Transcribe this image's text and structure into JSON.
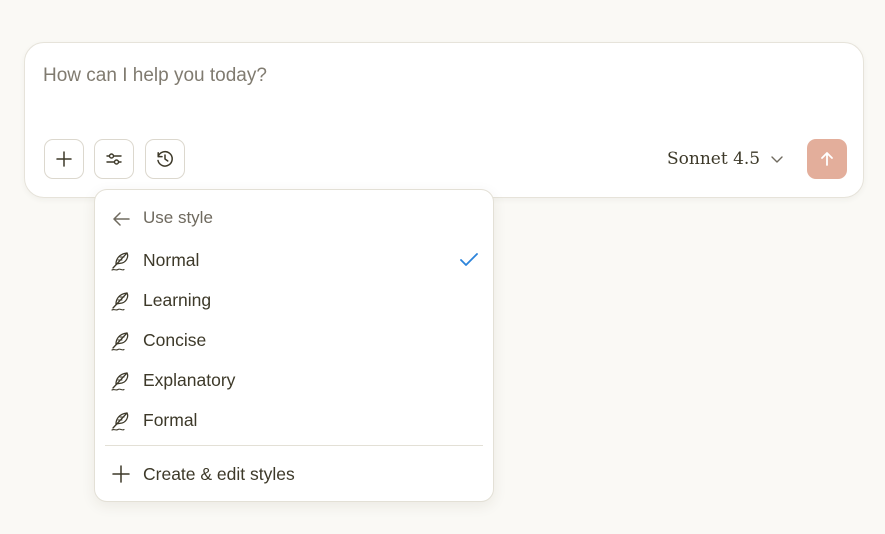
{
  "composer": {
    "placeholder": "How can I help you today?",
    "model_label": "Sonnet 4.5",
    "toolbar": {
      "add_icon": "plus-icon",
      "tools_icon": "sliders-icon",
      "history_icon": "history-clock-icon",
      "send_icon": "arrow-up-icon"
    },
    "send_button_color": "#e3ae9b"
  },
  "style_menu": {
    "header_label": "Use style",
    "items": [
      {
        "label": "Normal",
        "selected": true
      },
      {
        "label": "Learning",
        "selected": false
      },
      {
        "label": "Concise",
        "selected": false
      },
      {
        "label": "Explanatory",
        "selected": false
      },
      {
        "label": "Formal",
        "selected": false
      }
    ],
    "create_label": "Create & edit styles",
    "check_color": "#2c84db"
  }
}
